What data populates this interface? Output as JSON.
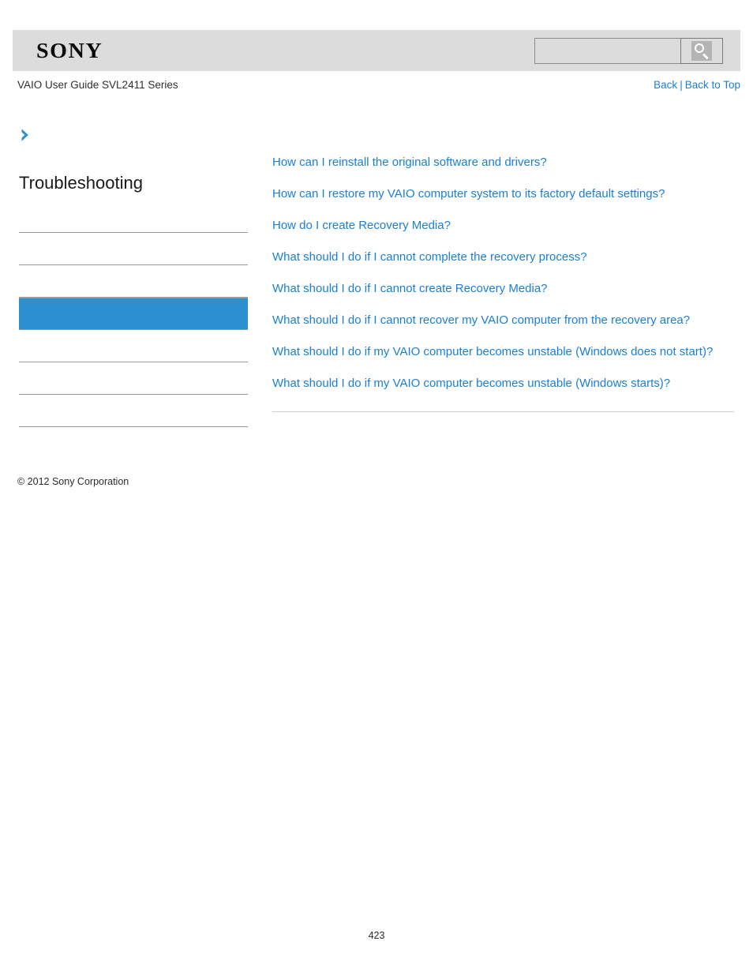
{
  "header": {
    "logo_text": "SONY",
    "guide_title": "VAIO User Guide SVL2411 Series",
    "back_label": "Back",
    "separator": "|",
    "back_to_top_label": "Back to Top"
  },
  "search": {
    "value": "",
    "placeholder": "",
    "button_icon": "search-icon"
  },
  "sidebar": {
    "chevron_icon": "chevron-right-icon",
    "heading": "Troubleshooting",
    "items": [
      {
        "label": "",
        "selected": false
      },
      {
        "label": "",
        "selected": false
      },
      {
        "label": "",
        "selected": false
      },
      {
        "label": "",
        "selected": true
      },
      {
        "label": "",
        "selected": false
      },
      {
        "label": "",
        "selected": false
      },
      {
        "label": "",
        "selected": false
      }
    ]
  },
  "content": {
    "links": [
      "How can I reinstall the original software and drivers?",
      "How can I restore my VAIO computer system to its factory default settings?",
      "How do I create Recovery Media?",
      "What should I do if I cannot complete the recovery process?",
      "What should I do if I cannot create Recovery Media?",
      "What should I do if I cannot recover my VAIO computer from the recovery area?",
      "What should I do if my VAIO computer becomes unstable (Windows does not start)?",
      "What should I do if my VAIO computer becomes unstable (Windows starts)?"
    ]
  },
  "footer": {
    "copyright": "© 2012 Sony Corporation",
    "page_number": "423"
  },
  "colors": {
    "link": "#1a7fd4",
    "selected_item": "#2b8fd0",
    "header_band": "#dcdcdc",
    "divider": "#9a9a9a"
  }
}
